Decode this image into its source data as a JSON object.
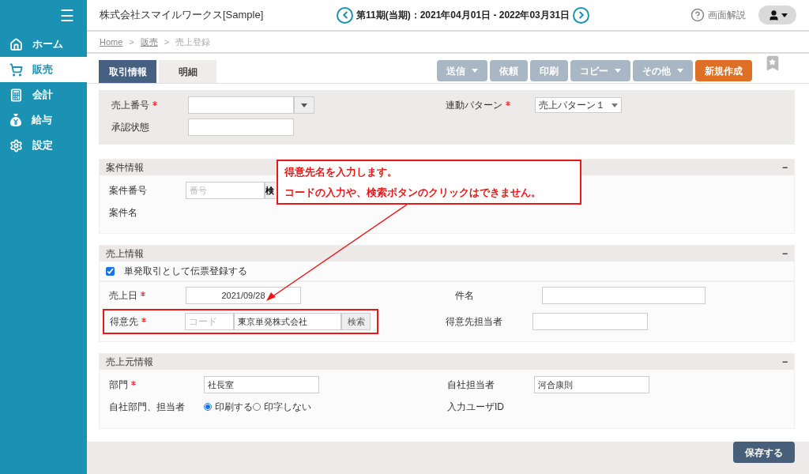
{
  "sidebar": {
    "menu": "☰",
    "items": [
      {
        "label": "ホーム",
        "selected": false
      },
      {
        "label": "販売",
        "selected": true
      },
      {
        "label": "会計",
        "selected": false
      },
      {
        "label": "給与",
        "selected": false
      },
      {
        "label": "設定",
        "selected": false
      }
    ]
  },
  "header": {
    "company": "株式会社スマイルワークス[Sample]",
    "period": "第11期(当期)：2021年04月01日 - 2022年03月31日",
    "help": "画面解説"
  },
  "breadcrumb": [
    {
      "label": "Home",
      "link": true
    },
    {
      "label": ">",
      "link": false
    },
    {
      "label": "販売",
      "link": true
    },
    {
      "label": ">",
      "link": false
    },
    {
      "label": "売上登録",
      "link": false
    }
  ],
  "tabs": [
    {
      "label": "取引情報",
      "selected": true
    },
    {
      "label": "明細",
      "selected": false
    }
  ],
  "actions": [
    {
      "label": "送信",
      "dropdown": true,
      "disabled": true
    },
    {
      "label": "依頼",
      "dropdown": false,
      "disabled": true
    },
    {
      "label": "印刷",
      "dropdown": false,
      "disabled": true
    },
    {
      "label": "コピー",
      "dropdown": true,
      "disabled": true
    },
    {
      "label": "その他",
      "dropdown": true,
      "disabled": true
    },
    {
      "label": "新規作成",
      "dropdown": false,
      "disabled": false
    }
  ],
  "top": {
    "sales_no": {
      "label": "売上番号",
      "required": true
    },
    "approval": {
      "label": "承認状態"
    },
    "pattern": {
      "label": "連動パターン",
      "required": true,
      "value": "売上パターン１"
    }
  },
  "project": {
    "title": "案件情報",
    "collapse": "−",
    "number": {
      "label": "案件番号",
      "placeholder": "番号",
      "button": "検"
    },
    "name": {
      "label": "案件名"
    }
  },
  "sales": {
    "title": "売上情報",
    "collapse": "−",
    "one_off": {
      "label": "単発取引として伝票登録する",
      "checked": true
    },
    "date": {
      "label": "売上日",
      "required": true,
      "value": "2021/09/28"
    },
    "customer": {
      "label": "得意先",
      "required": true,
      "code_placeholder": "コード",
      "value": "東京単発株式会社",
      "button": "検索"
    },
    "subject": {
      "label": "件名"
    },
    "contact": {
      "label": "得意先担当者"
    }
  },
  "origin": {
    "title": "売上元情報",
    "collapse": "−",
    "dept": {
      "label": "部門",
      "required": true,
      "value": "社長室"
    },
    "print": {
      "label": "自社部門、担当者",
      "options": [
        {
          "label": "印刷する",
          "selected": true
        },
        {
          "label": "印字しない",
          "selected": false
        }
      ]
    },
    "staff": {
      "label": "自社担当者",
      "value": "河合康則"
    },
    "user_id": {
      "label": "入力ユーザID"
    }
  },
  "callout": {
    "lines": [
      "得意先名を入力します。",
      "コードの入力や、検索ボタンのクリックはできません。"
    ]
  },
  "save": "保存する"
}
